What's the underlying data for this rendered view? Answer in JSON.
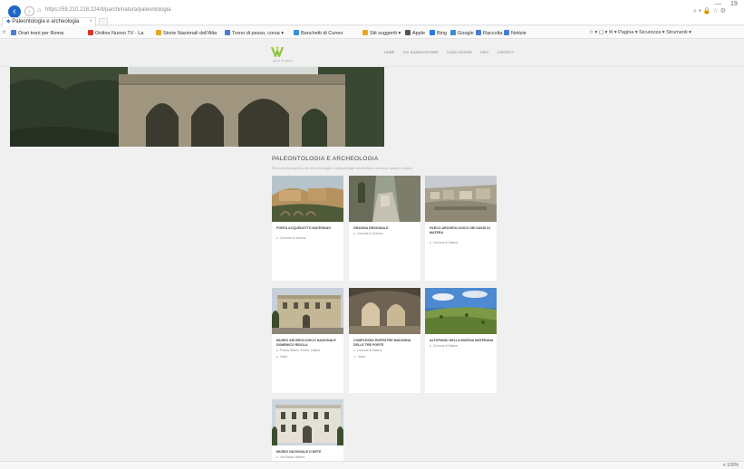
{
  "browser": {
    "url": "https://59.210.218.224/it/parchi/natura/paleontologia",
    "tab_title": "Paleontologia e archeologia",
    "tab_close": "×",
    "window_minimize": "—",
    "window_maximize": "19",
    "toolbar_right": "⌕ ▾ 🔒 ☆ ⚙",
    "bookmarks": [
      {
        "label": "Orari treni per Roma",
        "color": "#4a7bd6"
      },
      {
        "label": "Ordine Nuovo TV · La",
        "color": "#d9352c"
      },
      {
        "label": "Storie Nazionali dell'Alta",
        "color": "#e8a623"
      },
      {
        "label": "Treno di passo, corsa ▾",
        "color": "#4a7bd6"
      },
      {
        "label": "Banchetti di Cuneo",
        "color": "#3a8ed6"
      },
      {
        "label": "Siti suggeriti ▾",
        "color": "#e8a623"
      },
      {
        "label": "Apple",
        "color": "#555555"
      },
      {
        "label": "Bing",
        "color": "#2a7ae2"
      },
      {
        "label": "Google",
        "color": "#3a8ed6"
      },
      {
        "label": "Raccolta",
        "color": "#4a7bd6"
      },
      {
        "label": "Notizie",
        "color": "#4a7bd6"
      }
    ],
    "command_bar": "☆ ▾ ▢ ▾ ✉ ▾ Pagina ▾ Sicurezza ▾ Strumenti ▾",
    "zoom": "≡ 100%"
  },
  "site": {
    "logo_tagline": "parchi di matera",
    "nav": [
      "Home",
      "Chi siamo/visitare",
      "Cosa vedere",
      "Info",
      "Contatti"
    ],
    "section_title": "PALEONTOLOGIA E ARCHEOLOGIA",
    "section_subtitle": "Percorsi alla scoperta dei siti archeologici e paleontologici del territorio, tra storia, natura e cultura.",
    "cards": [
      {
        "title": "PORTA ACQUEDOTTO MATERANO",
        "location": "Comune di Gravina",
        "extra": ""
      },
      {
        "title": "GRAVINA REGIONALE",
        "location": "Comune di Gravina",
        "extra": ""
      },
      {
        "title": "PARCO ARCHEOLOGICO DEI SASSI DI MATERA",
        "location": "Comune di Matera",
        "extra": ""
      },
      {
        "title": "MUSEO ARCHEOLOGICO NAZIONALE DOMENICO RIDOLA",
        "location": "Piazza Vittorio Veneto, Matera",
        "extra": "Visita"
      },
      {
        "title": "COMPLESSO RUPESTRE MADONNA DELLE TRE PORTE",
        "location": "Comune di Matera",
        "extra": "Sassi"
      },
      {
        "title": "ALTOPIANO DELLA MURGIA MATERANA",
        "location": "Comune di Matera",
        "extra": ""
      },
      {
        "title": "MUSEO NAZIONALE D'ARTE",
        "location": "Via Ridola, Matera",
        "extra": ""
      }
    ]
  },
  "colors": {
    "accent_green": "#7ab340",
    "browser_blue": "#1e66c9"
  }
}
